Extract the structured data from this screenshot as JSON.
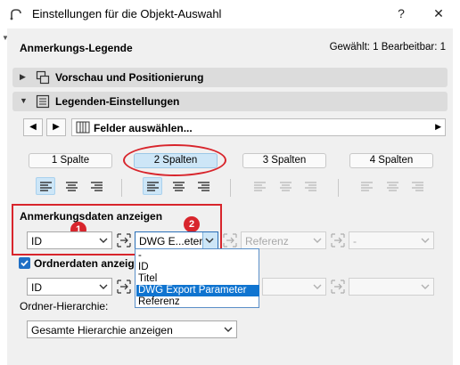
{
  "window": {
    "title": "Einstellungen für die Objekt-Auswahl",
    "help_label": "?",
    "close_label": "✕"
  },
  "header": {
    "title": "Anmerkungs-Legende",
    "status": "Gewählt: 1 Bearbeitbar: 1"
  },
  "sections": {
    "preview": "Vorschau und Positionierung",
    "legend": "Legenden-Einstellungen"
  },
  "field_selector": {
    "label": "Felder auswählen..."
  },
  "columns": {
    "col1": "1 Spalte",
    "col2": "2 Spalten",
    "col3": "3 Spalten",
    "col4": "4 Spalten",
    "selected": "2 Spalten"
  },
  "annotation_data": {
    "heading": "Anmerkungsdaten anzeigen",
    "badge1": "1",
    "badge2": "2",
    "field1_value": "ID",
    "field2_value": "DWG E...eter",
    "field3_value": "Referenz",
    "field4_value": "-"
  },
  "dropdown_list": {
    "items": [
      "-",
      "ID",
      "Titel",
      "DWG Export Parameter",
      "Referenz"
    ],
    "highlighted": "DWG Export Parameter"
  },
  "folder_data": {
    "checkbox_label": "Ordnerdaten anzeigen",
    "checked": true,
    "field1_value": "ID"
  },
  "hierarchy": {
    "label": "Ordner-Hierarchie:",
    "value": "Gesamte Hierarchie anzeigen"
  },
  "colors": {
    "accent": "#1f6fc5",
    "highlight": "#0f74d0",
    "annotation_red": "#d8252c",
    "selected_button": "#cde6f7"
  }
}
